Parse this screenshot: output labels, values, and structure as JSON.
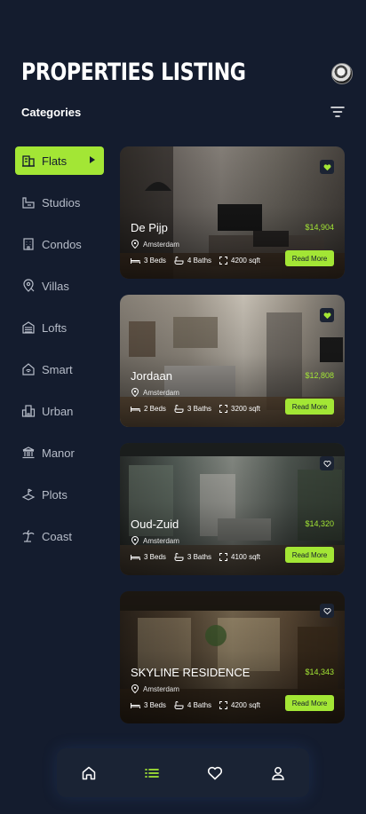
{
  "header": {
    "title": "PROPERTIES LISTING",
    "avatar_icon": "user-avatar",
    "categories_label": "Categories",
    "filter_icon": "filter-icon"
  },
  "colors": {
    "background": "#141c2e",
    "accent": "#a3e635",
    "muted_text": "#b7bdc9",
    "nav_bg": "#1a2334"
  },
  "categories": [
    {
      "label": "Flats",
      "icon": "building-icon",
      "active": true
    },
    {
      "label": "Studios",
      "icon": "studio-icon",
      "active": false
    },
    {
      "label": "Condos",
      "icon": "condo-icon",
      "active": false
    },
    {
      "label": "Villas",
      "icon": "villa-icon",
      "active": false
    },
    {
      "label": "Lofts",
      "icon": "loft-icon",
      "active": false
    },
    {
      "label": "Smart",
      "icon": "smart-home-icon",
      "active": false
    },
    {
      "label": "Urban",
      "icon": "urban-icon",
      "active": false
    },
    {
      "label": "Manor",
      "icon": "manor-icon",
      "active": false
    },
    {
      "label": "Plots",
      "icon": "plot-icon",
      "active": false
    },
    {
      "label": "Coast",
      "icon": "palm-tree-icon",
      "active": false
    }
  ],
  "properties": [
    {
      "name": "De Pijp",
      "price": "$14,904",
      "location": "Amsterdam",
      "beds": "3 Beds",
      "baths": "4 Baths",
      "area": "4200 sqft",
      "cta": "Read More",
      "favorited": true
    },
    {
      "name": "Jordaan",
      "price": "$12,808",
      "location": "Amsterdam",
      "beds": "2 Beds",
      "baths": "3 Baths",
      "area": "3200 sqft",
      "cta": "Read More",
      "favorited": true
    },
    {
      "name": "Oud-Zuid",
      "price": "$14,320",
      "location": "Amsterdam",
      "beds": "3 Beds",
      "baths": "3 Baths",
      "area": "4100 sqft",
      "cta": "Read More",
      "favorited": false
    },
    {
      "name": "SKYLINE RESIDENCE",
      "price": "$14,343",
      "location": "Amsterdam",
      "beds": "3 Beds",
      "baths": "4 Baths",
      "area": "4200 sqft",
      "cta": "Read More",
      "favorited": false
    }
  ],
  "bottom_nav": [
    {
      "icon": "home-icon",
      "active": false
    },
    {
      "icon": "list-icon",
      "active": true
    },
    {
      "icon": "heart-icon",
      "active": false
    },
    {
      "icon": "profile-icon",
      "active": false
    }
  ]
}
